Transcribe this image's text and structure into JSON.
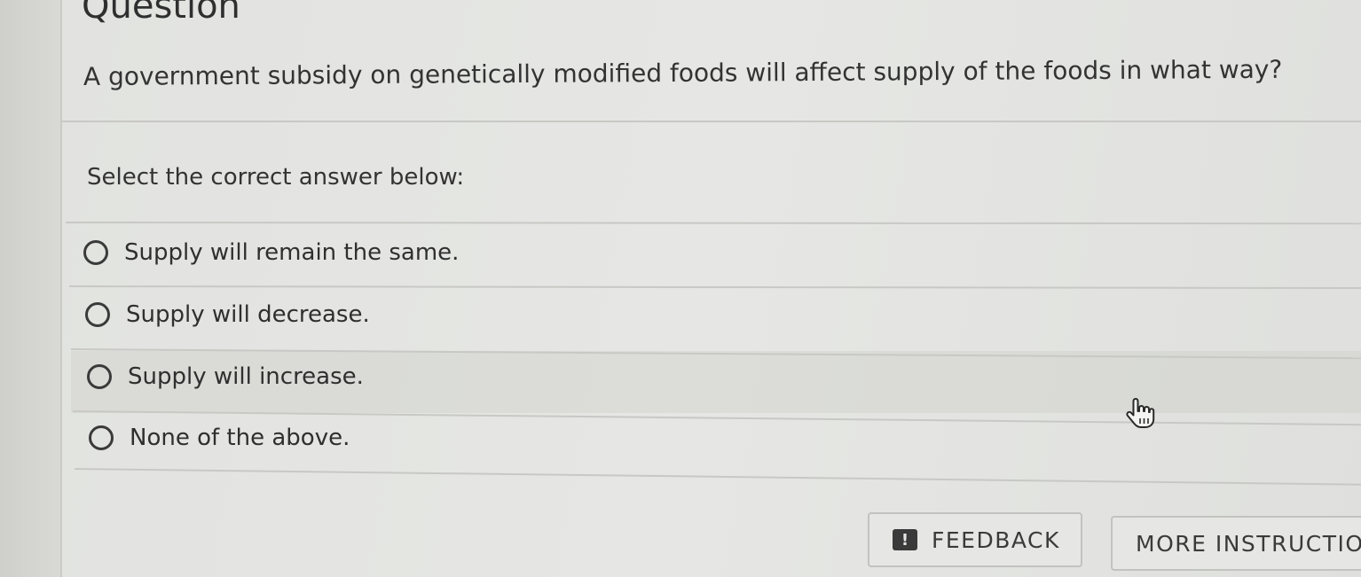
{
  "title": "Question",
  "question": "A government subsidy on genetically modified foods will affect supply of the foods in what way?",
  "prompt": "Select the correct answer below:",
  "options": [
    {
      "label": "Supply will remain the same."
    },
    {
      "label": "Supply will decrease."
    },
    {
      "label": "Supply will increase."
    },
    {
      "label": "None of the above."
    }
  ],
  "buttons": {
    "feedback": "FEEDBACK",
    "feedback_icon": "!",
    "more_instructions": "MORE INSTRUCTIO"
  },
  "icons": {
    "radio": "radio-unselected-icon",
    "feedback": "exclamation-icon",
    "cursor": "hand-pointer-icon"
  }
}
